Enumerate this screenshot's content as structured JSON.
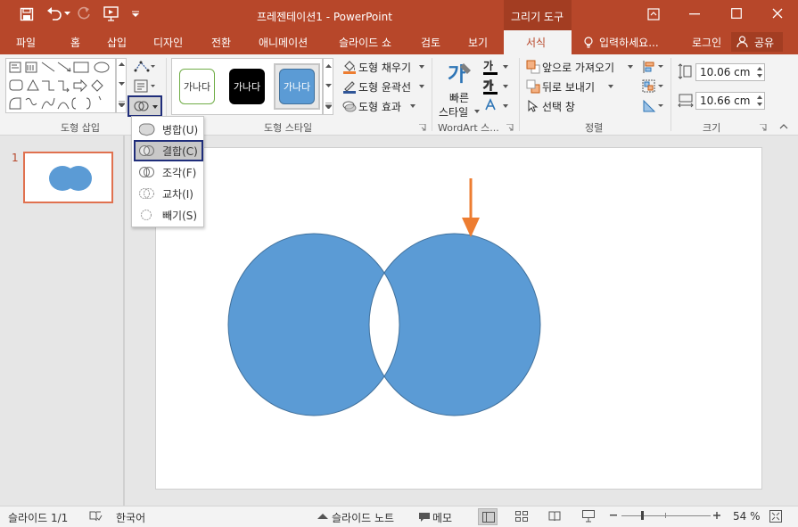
{
  "titlebar": {
    "doc_title": "프레젠테이션1 - PowerPoint",
    "context_tab": "그리기 도구"
  },
  "tabs": [
    {
      "label": "파일"
    },
    {
      "label": "홈"
    },
    {
      "label": "삽입"
    },
    {
      "label": "디자인"
    },
    {
      "label": "전환"
    },
    {
      "label": "애니메이션"
    },
    {
      "label": "슬라이드 쇼"
    },
    {
      "label": "검토"
    },
    {
      "label": "보기"
    },
    {
      "label": "서식"
    }
  ],
  "tell_me": "입력하세요...",
  "login": "로그인",
  "share": "공유",
  "ribbon": {
    "group_insert_shapes": "도형 삽입",
    "group_shape_styles": "도형 스타일",
    "group_wordart": "WordArt 스...",
    "group_arrange": "정렬",
    "group_size": "크기",
    "style_sample_text": "가나다",
    "shape_fill": "도형 채우기",
    "shape_outline": "도형 윤곽선",
    "shape_effects": "도형 효과",
    "quick_styles_line1": "빠른",
    "quick_styles_line2": "스타일",
    "wordart_a": "가",
    "bring_forward": "앞으로 가져오기",
    "send_backward": "뒤로 보내기",
    "selection_pane": "선택 창",
    "height_value": "10.06 cm",
    "width_value": "10.66 cm"
  },
  "merge_menu": {
    "items": [
      {
        "label": "병합(U)"
      },
      {
        "label": "결합(C)"
      },
      {
        "label": "조각(F)"
      },
      {
        "label": "교차(I)"
      },
      {
        "label": "빼기(S)"
      }
    ]
  },
  "thumbnail": {
    "number": "1"
  },
  "statusbar": {
    "slide_info": "슬라이드 1/1",
    "language": "한국어",
    "notes": "슬라이드 노트",
    "comments": "메모",
    "zoom": "54 %"
  },
  "colors": {
    "accent": "#b7472a",
    "shape_fill": "#5b9bd5",
    "arrow": "#ed7d31",
    "highlight_border": "#1f2d7a"
  }
}
